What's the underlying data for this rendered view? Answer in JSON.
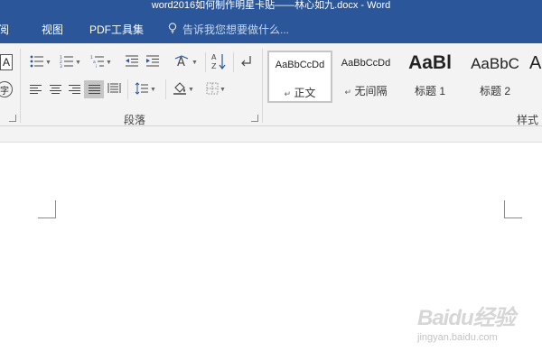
{
  "window": {
    "title": "word2016如何制作明星卡贴——林心如九.docx - Word"
  },
  "tabs": [
    {
      "label": "阅"
    },
    {
      "label": "视图"
    },
    {
      "label": "PDF工具集"
    }
  ],
  "tell_me": {
    "placeholder": "告诉我您想要做什么..."
  },
  "ribbon": {
    "font_group": {
      "char_border_label": "A",
      "enclosed_char_label": "字"
    },
    "paragraph_group": {
      "label": "段落",
      "sort_label": "A↓Z",
      "asian_layout_label": "A"
    },
    "styles_group": {
      "label": "样式",
      "items": [
        {
          "sample": "AaBbCcDd",
          "name": "正文",
          "marker": "↵"
        },
        {
          "sample": "AaBbCcDd",
          "name": "无间隔",
          "marker": "↵"
        },
        {
          "sample": "AaBl",
          "name": "标题 1"
        },
        {
          "sample": "AaBbC",
          "name": "标题 2"
        },
        {
          "sample": "A",
          "name": ""
        }
      ]
    }
  },
  "watermark": {
    "logo": "Baidu经验",
    "url": "jingyan.baidu.com"
  },
  "colors": {
    "title_bar": "#2b579a",
    "ribbon_bg": "#f3f3f3",
    "selected_button": "#c5c5c5",
    "page": "#ffffff"
  }
}
